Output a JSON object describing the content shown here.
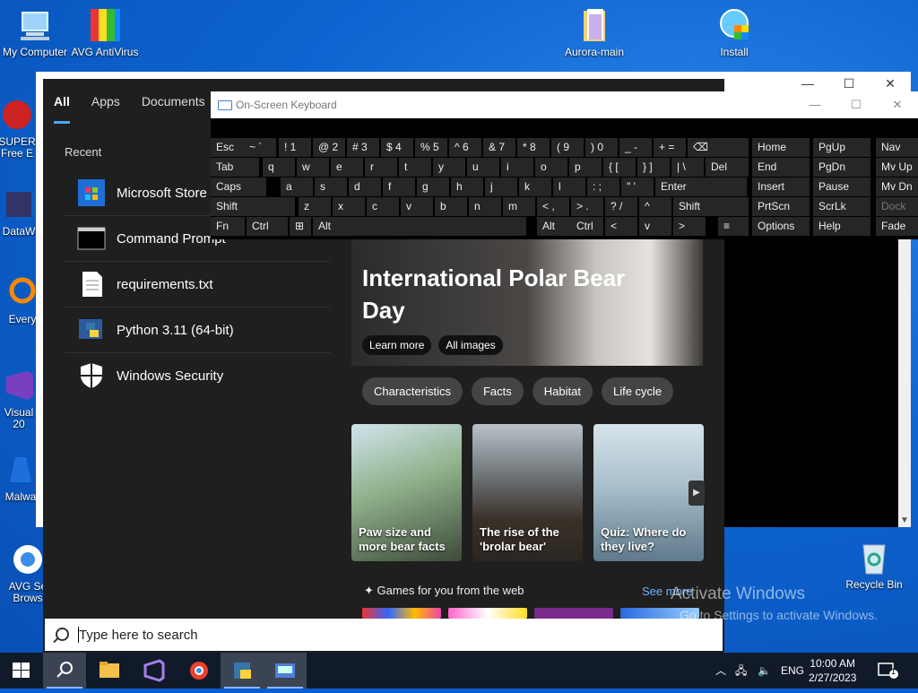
{
  "desktop": {
    "icons": [
      {
        "label": "My Computer"
      },
      {
        "label": "AVG AntiVirus"
      },
      {
        "label": "Aurora-main"
      },
      {
        "label": "Install"
      },
      {
        "label": "Recycle Bin"
      }
    ],
    "partial_labels": [
      "SUPER",
      "Free E",
      "DataW",
      "Every",
      "Visual",
      "20",
      "Malwa",
      "AVG Se",
      "Brows"
    ]
  },
  "start_menu": {
    "tabs": [
      {
        "label": "All"
      },
      {
        "label": "Apps"
      },
      {
        "label": "Documents"
      }
    ],
    "recent_heading": "Recent",
    "recent": [
      {
        "label": "Microsoft Store",
        "icon": "store-icon"
      },
      {
        "label": "Command Prompt",
        "icon": "cmd-icon"
      },
      {
        "label": "requirements.txt",
        "icon": "text-file-icon"
      },
      {
        "label": "Python 3.11 (64-bit)",
        "icon": "python-icon"
      },
      {
        "label": "Windows Security",
        "icon": "shield-icon"
      }
    ],
    "hero": {
      "title": "International Polar Bear Day",
      "buttons": [
        "Learn more",
        "All images"
      ]
    },
    "chips": [
      "Characteristics",
      "Facts",
      "Habitat",
      "Life cycle"
    ],
    "cards": [
      {
        "caption": "Paw size and more bear facts"
      },
      {
        "caption": "The rise of the 'brolar bear'"
      },
      {
        "caption": "Quiz: Where do they live?"
      }
    ],
    "games_heading": "Games for you from the web",
    "see_more": "See more"
  },
  "keyboard": {
    "title": "On-Screen Keyboard",
    "rows": [
      [
        [
          "Esc",
          "Esc"
        ],
        [
          "~ `",
          "tilde"
        ],
        [
          "! 1",
          "1"
        ],
        [
          "@ 2",
          "2"
        ],
        [
          "# 3",
          "3"
        ],
        [
          "$ 4",
          "4"
        ],
        [
          "% 5",
          "5"
        ],
        [
          "^ 6",
          "6"
        ],
        [
          "& 7",
          "7"
        ],
        [
          "* 8",
          "8"
        ],
        [
          "( 9",
          "9"
        ],
        [
          ") 0",
          "0"
        ],
        [
          "_ -",
          "minus"
        ],
        [
          "+ =",
          "equals"
        ],
        [
          "⌫",
          "backspace"
        ],
        [
          "Home",
          "Home"
        ],
        [
          "PgUp",
          "PgUp"
        ],
        [
          "Nav",
          "Nav"
        ]
      ],
      [
        [
          "Tab",
          "Tab"
        ],
        [
          "q",
          "q"
        ],
        [
          "w",
          "w"
        ],
        [
          "e",
          "e"
        ],
        [
          "r",
          "r"
        ],
        [
          "t",
          "t"
        ],
        [
          "y",
          "y"
        ],
        [
          "u",
          "u"
        ],
        [
          "i",
          "i"
        ],
        [
          "o",
          "o"
        ],
        [
          "p",
          "p"
        ],
        [
          "{ [",
          "lbracket"
        ],
        [
          "} ]",
          "rbracket"
        ],
        [
          "| \\",
          "backslash"
        ],
        [
          "Del",
          "Del"
        ],
        [
          "End",
          "End"
        ],
        [
          "PgDn",
          "PgDn"
        ],
        [
          "Mv Up",
          "MvUp"
        ]
      ],
      [
        [
          "Caps",
          "Caps"
        ],
        [
          "a",
          "a"
        ],
        [
          "s",
          "s"
        ],
        [
          "d",
          "d"
        ],
        [
          "f",
          "f"
        ],
        [
          "g",
          "g"
        ],
        [
          "h",
          "h"
        ],
        [
          "j",
          "j"
        ],
        [
          "k",
          "k"
        ],
        [
          "l",
          "l"
        ],
        [
          ": ;",
          "semicolon"
        ],
        [
          "\" '",
          "quote"
        ],
        [
          "Enter",
          "Enter"
        ],
        [
          "Insert",
          "Insert"
        ],
        [
          "Pause",
          "Pause"
        ],
        [
          "Mv Dn",
          "MvDn"
        ]
      ],
      [
        [
          "Shift",
          "Shift"
        ],
        [
          "z",
          "z"
        ],
        [
          "x",
          "x"
        ],
        [
          "c",
          "c"
        ],
        [
          "v",
          "v"
        ],
        [
          "b",
          "b"
        ],
        [
          "n",
          "n"
        ],
        [
          "m",
          "m"
        ],
        [
          "< ,",
          "comma"
        ],
        [
          "> .",
          "period"
        ],
        [
          "? /",
          "slash"
        ],
        [
          "^",
          "up"
        ],
        [
          "Shift",
          "ShiftR"
        ],
        [
          "PrtScn",
          "PrtScn"
        ],
        [
          "ScrLk",
          "ScrLk"
        ],
        [
          "Dock",
          "Dock"
        ]
      ],
      [
        [
          "Fn",
          "Fn"
        ],
        [
          "Ctrl",
          "Ctrl"
        ],
        [
          "⊞",
          "win"
        ],
        [
          "Alt",
          "Alt"
        ],
        [
          "Alt",
          "AltR"
        ],
        [
          "Ctrl",
          "CtrlR"
        ],
        [
          "<",
          "left"
        ],
        [
          "v",
          "down"
        ],
        [
          ">",
          "right"
        ],
        [
          "≡",
          "menu"
        ],
        [
          "Options",
          "Options"
        ],
        [
          "Help",
          "Help"
        ],
        [
          "Fade",
          "Fade"
        ]
      ]
    ]
  },
  "search": {
    "placeholder": "Type here to search"
  },
  "watermark": {
    "line1": "Activate Windows",
    "line2": "Go to Settings to activate Windows."
  },
  "taskbar": {
    "language": "ENG",
    "time": "10:00 AM",
    "date": "2/27/2023",
    "notification_count": "1"
  },
  "colors": {
    "accent": "#4ca7ff",
    "start_bg": "#1f1f1f",
    "taskbar_bg": "#111a29",
    "desktop_blue": "#0d63cf"
  }
}
